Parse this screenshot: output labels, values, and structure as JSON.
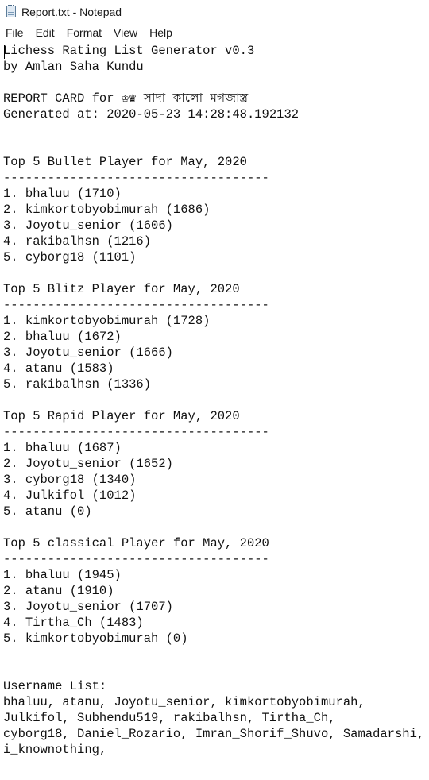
{
  "window": {
    "title": "Report.txt - Notepad"
  },
  "menu": [
    "File",
    "Edit",
    "Format",
    "View",
    "Help"
  ],
  "document": {
    "text": "Lichess Rating List Generator v0.3\nby Amlan Saha Kundu\n\nREPORT CARD for ♔♛ সাদা কালো মগজাস্ত্র\nGenerated at: 2020-05-23 14:28:48.192132\n\n\nTop 5 Bullet Player for May, 2020\n------------------------------------\n1. bhaluu (1710)\n2. kimkortobyobimurah (1686)\n3. Joyotu_senior (1606)\n4. rakibalhsn (1216)\n5. cyborg18 (1101)\n\nTop 5 Blitz Player for May, 2020\n------------------------------------\n1. kimkortobyobimurah (1728)\n2. bhaluu (1672)\n3. Joyotu_senior (1666)\n4. atanu (1583)\n5. rakibalhsn (1336)\n\nTop 5 Rapid Player for May, 2020\n------------------------------------\n1. bhaluu (1687)\n2. Joyotu_senior (1652)\n3. cyborg18 (1340)\n4. Julkifol (1012)\n5. atanu (0)\n\nTop 5 classical Player for May, 2020\n------------------------------------\n1. bhaluu (1945)\n2. atanu (1910)\n3. Joyotu_senior (1707)\n4. Tirtha_Ch (1483)\n5. kimkortobyobimurah (0)\n\n\nUsername List:\nbhaluu, atanu, Joyotu_senior, kimkortobyobimurah,\nJulkifol, Subhendu519, rakibalhsn, Tirtha_Ch,\ncyborg18, Daniel_Rozario, Imran_Shorif_Shuvo, Samadarshi,\ni_knownothing,"
  }
}
